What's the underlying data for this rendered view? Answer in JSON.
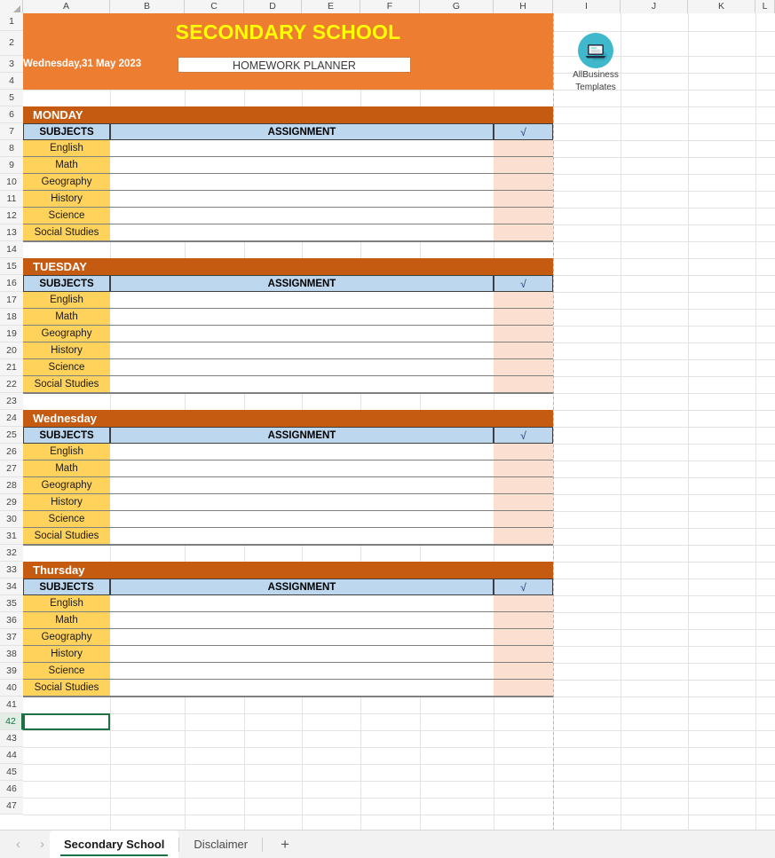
{
  "app": {
    "type": "spreadsheet",
    "columns": [
      "A",
      "B",
      "C",
      "D",
      "E",
      "F",
      "G",
      "H",
      "I",
      "J",
      "K",
      "L"
    ],
    "rows": [
      "1",
      "2",
      "3",
      "4",
      "5",
      "6",
      "7",
      "8",
      "9",
      "10",
      "11",
      "12",
      "13",
      "14",
      "15",
      "16",
      "17",
      "18",
      "19",
      "20",
      "21",
      "22",
      "23",
      "24",
      "25",
      "26",
      "27",
      "28",
      "29",
      "30",
      "31",
      "32",
      "33",
      "34",
      "35",
      "36",
      "37",
      "38",
      "39",
      "40",
      "41",
      "42",
      "43",
      "44",
      "45",
      "46",
      "47"
    ],
    "active_cell": "A42",
    "active_row": "42"
  },
  "banner": {
    "title": "SECONDARY SCHOOL",
    "date": "Wednesday,31 May 2023",
    "subtitle": "HOMEWORK PLANNER",
    "bg_color": "#ED7D31",
    "title_color": "#FFFF00"
  },
  "logo": {
    "line1": "AllBusiness",
    "line2": "Templates",
    "icon": "laptop-icon",
    "circle_color": "#3FB8CC"
  },
  "table_headers": {
    "subjects": "SUBJECTS",
    "assignment": "ASSIGNMENT",
    "check": "√",
    "header_bg": "#BDD7EE",
    "day_bg": "#C55A11",
    "subject_bg": "#FFD35B",
    "check_bg": "#FBE0D1"
  },
  "subjects": [
    "English",
    "Math",
    "Geography",
    "History",
    "Science",
    "Social Studies"
  ],
  "days": [
    {
      "name": "MONDAY",
      "header_row": "6",
      "subject_rows": [
        "8",
        "9",
        "10",
        "11",
        "12",
        "13"
      ]
    },
    {
      "name": "TUESDAY",
      "header_row": "15",
      "subject_rows": [
        "17",
        "18",
        "19",
        "20",
        "21",
        "22"
      ]
    },
    {
      "name": "Wednesday",
      "header_row": "24",
      "subject_rows": [
        "26",
        "27",
        "28",
        "29",
        "30",
        "31"
      ]
    },
    {
      "name": "Thursday",
      "header_row": "33",
      "subject_rows": [
        "35",
        "36",
        "37",
        "38",
        "39",
        "40"
      ]
    }
  ],
  "tabbar": {
    "prev_arrow": "‹",
    "next_arrow": "›",
    "add_label": "+",
    "sheets": [
      {
        "label": "Secondary School",
        "active": true
      },
      {
        "label": "Disclaimer",
        "active": false
      }
    ]
  }
}
